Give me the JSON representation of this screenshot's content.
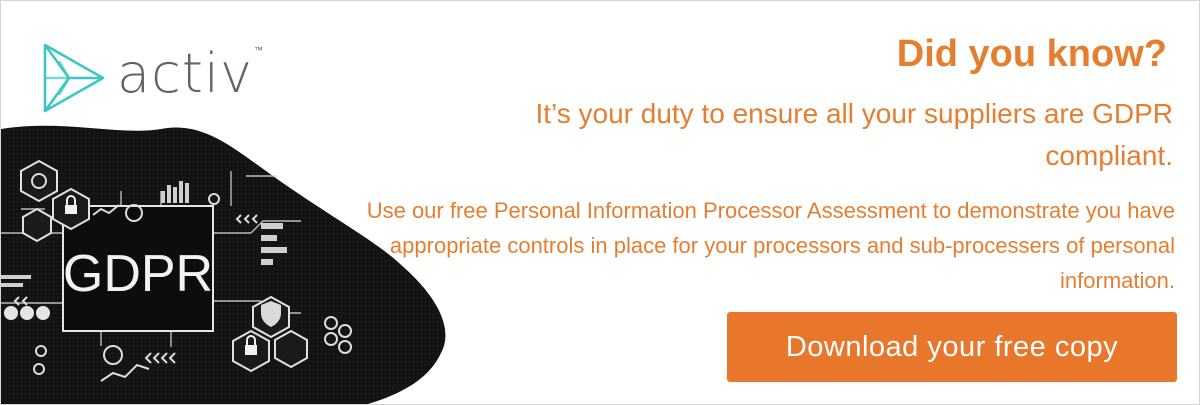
{
  "brand": {
    "name": "activ",
    "trademark": "™"
  },
  "graphic": {
    "label": "GDPR"
  },
  "headline": "Did you know?",
  "subheadline": "It’s your duty to ensure all your suppliers are GDPR compliant.",
  "body": "Use our free Personal Information Processor Assessment to demonstrate you have appropriate controls in place for your processors and sub-processers of personal information.",
  "cta": {
    "label": "Download your free copy"
  },
  "colors": {
    "accent": "#e67e30",
    "button": "#e8772c",
    "logo_text": "#606369",
    "logo_mark": "#3ec6c0",
    "graphic_bg": "#121212"
  }
}
